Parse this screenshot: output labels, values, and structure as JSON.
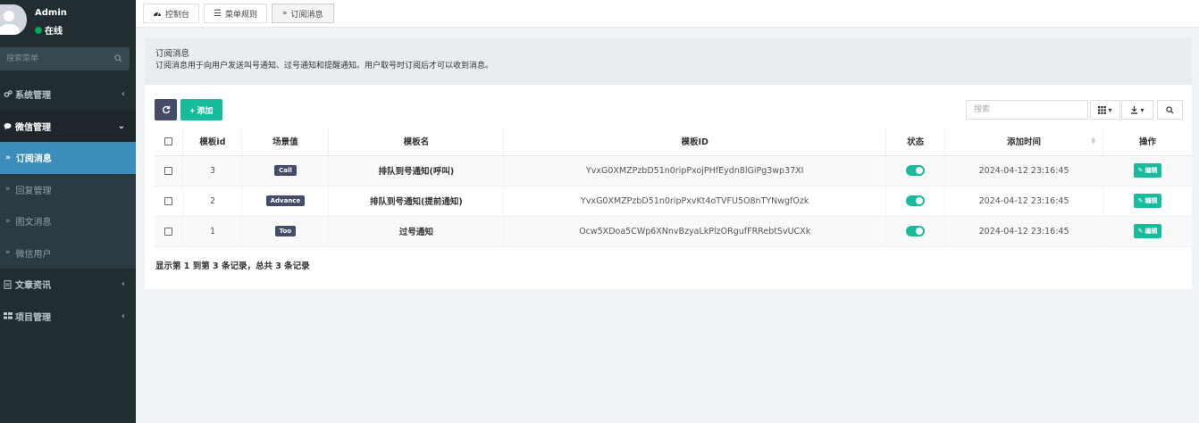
{
  "user": {
    "name": "Admin",
    "status": "在线"
  },
  "sidebar": {
    "search_placeholder": "搜索菜单",
    "items": [
      {
        "label": "系统管理",
        "icon": "cogs-icon"
      },
      {
        "label": "微信管理",
        "icon": "comments-icon",
        "open": true
      },
      {
        "label": "文章资讯",
        "icon": "file-icon"
      },
      {
        "label": "项目管理",
        "icon": "th-icon"
      }
    ],
    "subitems": [
      "订阅消息",
      "回复管理",
      "图文消息",
      "微信用户"
    ],
    "active_subitem": "订阅消息"
  },
  "tabs": [
    {
      "label": "控制台",
      "icon": "dashboard-icon"
    },
    {
      "label": "菜单规则",
      "icon": "list-icon"
    },
    {
      "label": "订阅消息",
      "icon": "chevron-right-icon",
      "active": true
    }
  ],
  "panel": {
    "title": "订阅消息",
    "description": "订阅消息用于向用户发送叫号通知、过号通知和提醒通知。用户取号时订阅后才可以收到消息。"
  },
  "toolbar": {
    "add_label": "+ 添加",
    "search_placeholder": "搜索"
  },
  "table": {
    "headers": [
      "模板id",
      "场景值",
      "模板名",
      "模板ID",
      "状态",
      "添加时间",
      "操作"
    ],
    "rows": [
      {
        "id": "3",
        "scene": "Call",
        "name": "排队到号通知(呼叫)",
        "template_id": "YvxG0XMZPzbD51n0ripPxojPHfEydn8lGiPg3wp37XI",
        "status": "on",
        "time": "2024-04-12 23:16:45",
        "action": "编辑"
      },
      {
        "id": "2",
        "scene": "Advance",
        "name": "排队到号通知(提前通知)",
        "template_id": "YvxG0XMZPzbD51n0ripPxvKt4oTVFU5O8nTYNwgfOzk",
        "status": "on",
        "time": "2024-04-12 23:16:45",
        "action": "编辑"
      },
      {
        "id": "1",
        "scene": "Too",
        "name": "过号通知",
        "template_id": "Ocw5XDoa5CWp6XNnvBzyaLkPlzORgufFRRebtSvUCXk",
        "status": "on",
        "time": "2024-04-12 23:16:45",
        "action": "编辑"
      }
    ]
  },
  "pager_text": "显示第 1 到第 3 条记录，总共 3 条记录",
  "colors": {
    "sidebar_bg": "#222d32",
    "active_blue": "#3c8dbc",
    "success": "#18bc9c",
    "dark_btn": "#444c69"
  }
}
